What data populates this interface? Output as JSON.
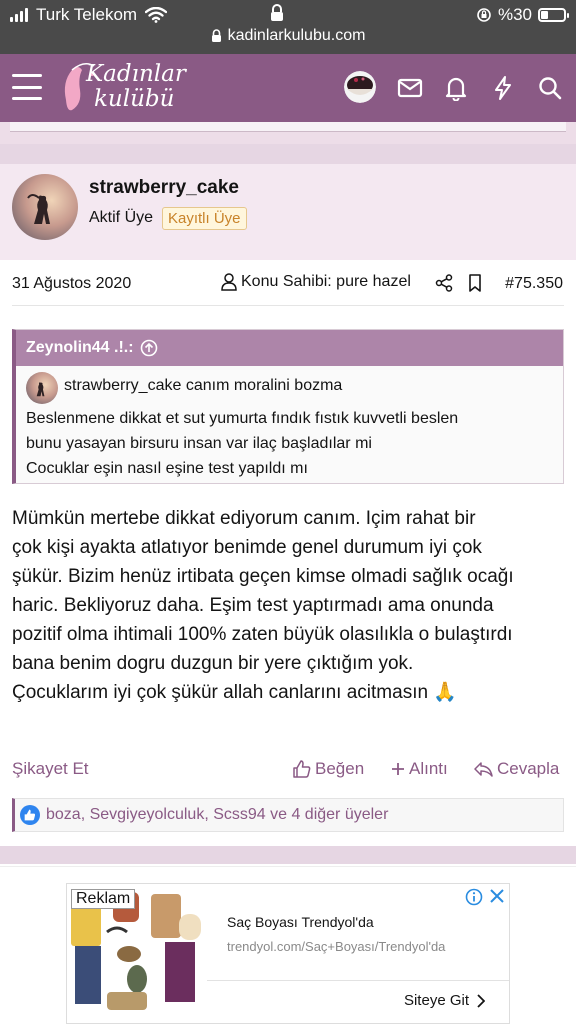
{
  "status_bar": {
    "carrier": "Turk Telekom",
    "battery_text": "%30",
    "battery_level": 0.3,
    "url": "kadinlarkulubu.com"
  },
  "header": {
    "logo_line1": "Kadınlar",
    "logo_line2": "kulübü",
    "brand_color": "#8a5a85",
    "icons": [
      "menu-icon",
      "avatar",
      "envelope-icon",
      "bell-icon",
      "bolt-icon",
      "search-icon"
    ]
  },
  "post": {
    "username": "strawberry_cake",
    "role": "Aktif Üye",
    "badge": "Kayıtlı Üye",
    "date": "31 Ağustos 2020",
    "owner_label": "Konu Sahibi: pure hazel",
    "post_number": "#75.350",
    "quote": {
      "author": "Zeynolin44 .!.:",
      "inner_user": "strawberry_cake",
      "inner_text": "canım moralini bozma",
      "lines": [
        "Beslenmene dikkat et sut yumurta fındık fıstık kuvvetli beslen",
        "bunu yasayan birsuru insan var ilaç başladılar mi",
        "Cocuklar eşin nasıl eşine test yapıldı mı"
      ]
    },
    "message_lines": [
      "Mümkün mertebe dikkat ediyorum canım. Içim rahat bir",
      "çok kişi ayakta atlatıyor benimde genel durumum iyi çok",
      "şükür. Bizim henüz irtibata geçen kimse olmadi sağlık ocağı",
      "haric. Bekliyoruz daha. Eşim test yaptırmadı ama onunda",
      "pozitif olma ihtimali 100% zaten büyük olasılıkla o bulaştırdı",
      "bana benim dogru duzgun bir yere çıktığım yok.",
      "Çocuklarım iyi çok şükür allah canlarını acitmasın 🙏"
    ],
    "actions": {
      "report": "Şikayet Et",
      "like": "Beğen",
      "quote": "Alıntı",
      "reply": "Cevapla"
    },
    "reactions_text": "boza, Sevgiyeyolculuk, Scss94 ve 4 diğer üyeler"
  },
  "ad": {
    "tag": "Reklam",
    "title": "Saç Boyası Trendyol'da",
    "url": "trendyol.com/Saç+Boyası/Trendyol'da",
    "cta": "Siteye Git"
  }
}
